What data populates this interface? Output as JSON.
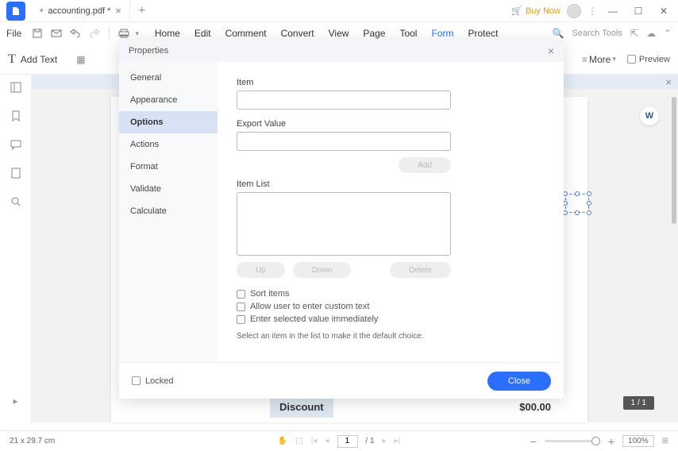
{
  "titlebar": {
    "tab_name": "accounting.pdf *",
    "buy_now": "Buy Now"
  },
  "menubar": {
    "file": "File",
    "items": [
      "Home",
      "Edit",
      "Comment",
      "Convert",
      "View",
      "Page",
      "Tool",
      "Form",
      "Protect"
    ],
    "search_placeholder": "Search Tools"
  },
  "toolbar": {
    "add_text": "Add Text",
    "more": "More",
    "preview": "Preview"
  },
  "dialog": {
    "title": "Properties",
    "tabs": [
      "General",
      "Appearance",
      "Options",
      "Actions",
      "Format",
      "Validate",
      "Calculate"
    ],
    "labels": {
      "item": "Item",
      "export_value": "Export Value",
      "item_list": "Item List"
    },
    "buttons": {
      "add": "Add",
      "up": "Up",
      "down": "Down",
      "delete": "Delete",
      "close": "Close"
    },
    "checkboxes": {
      "sort": "Sort items",
      "custom": "Allow user to enter custom text",
      "immediate": "Enter selected value immediately"
    },
    "hint": "Select an item in the list to make it the default choice.",
    "locked": "Locked"
  },
  "document": {
    "discount_label": "Discount",
    "discount_value": "$00.00"
  },
  "page_badge": "1 / 1",
  "statusbar": {
    "dimensions": "21 x 29.7 cm",
    "page_current": "1",
    "page_total": "/ 1",
    "zoom": "100%"
  }
}
